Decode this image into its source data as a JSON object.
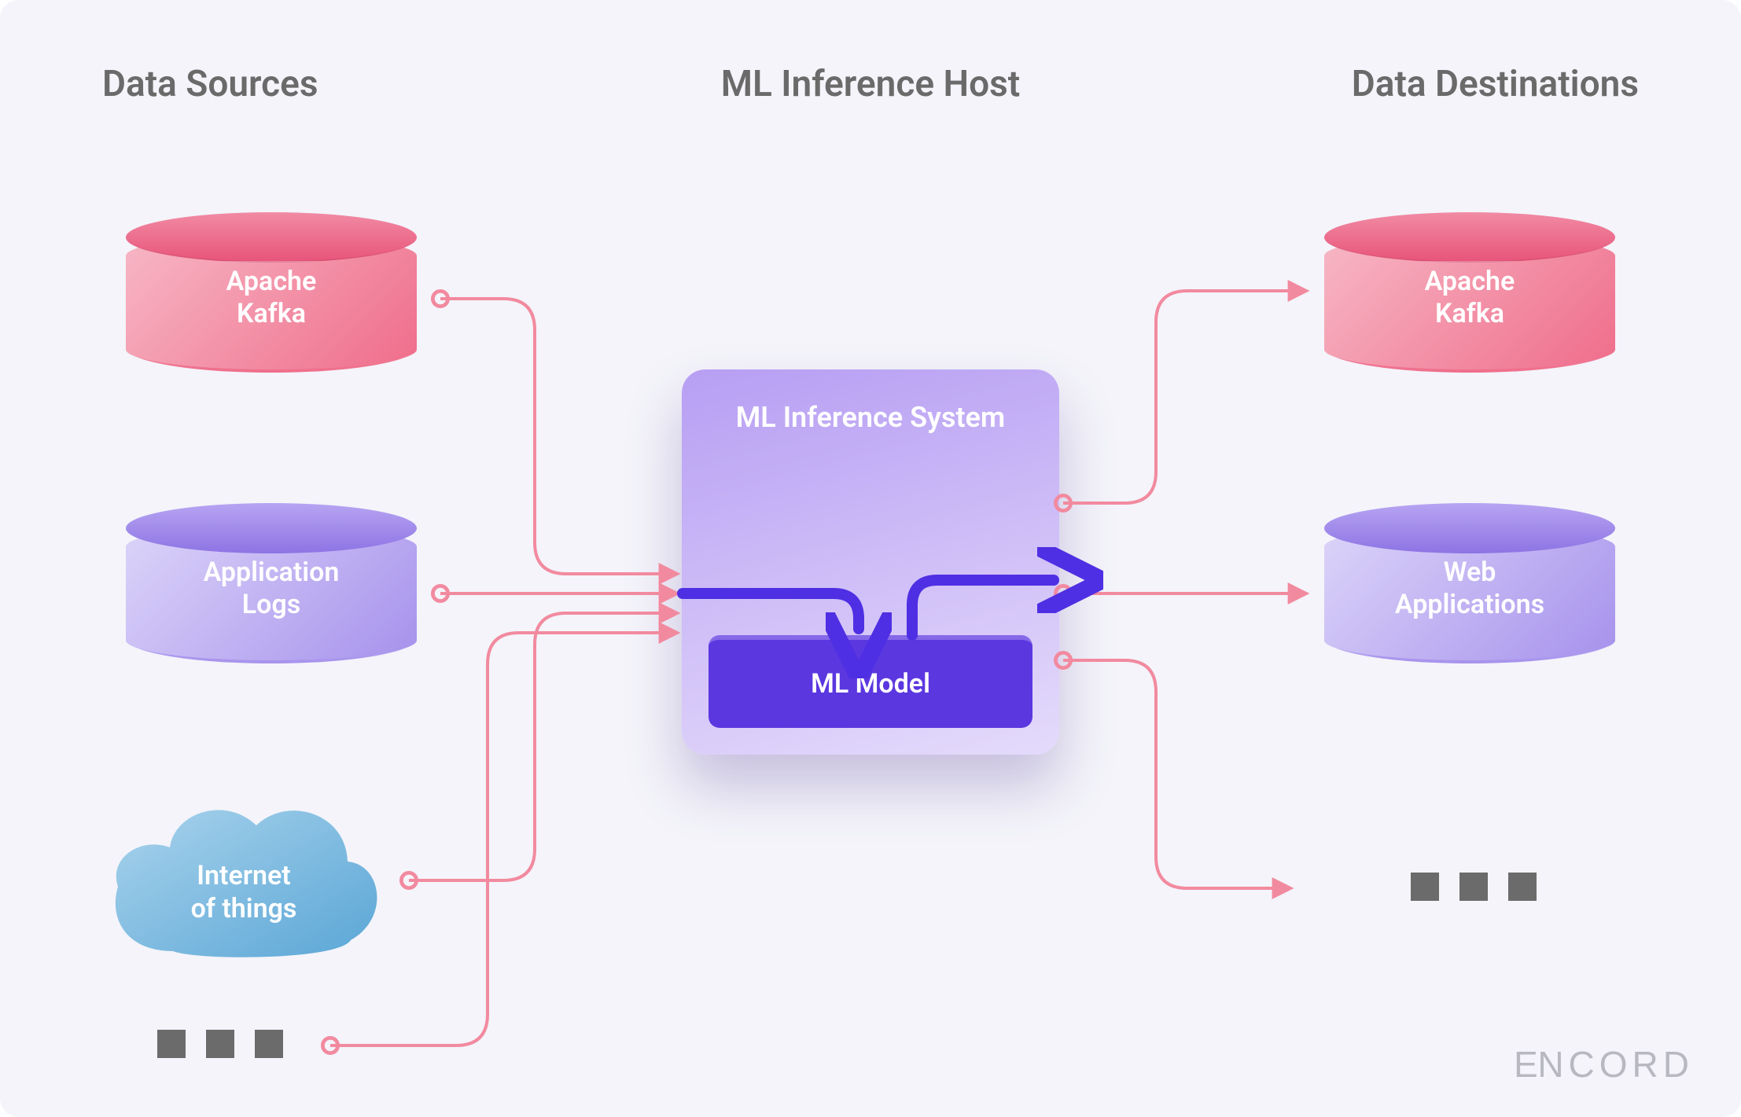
{
  "headings": {
    "sources": "Data Sources",
    "host": "ML Inference Host",
    "destinations": "Data Destinations"
  },
  "sources": {
    "kafka": "Apache\nKafka",
    "logs": "Application\nLogs",
    "iot": "Internet\nof things"
  },
  "center": {
    "system": "ML Inference System",
    "model": "ML Model"
  },
  "destinations": {
    "kafka": "Apache\nKafka",
    "webapps": "Web\nApplications"
  },
  "brand": "ENCORD",
  "colors": {
    "pink_arrows": "#f28a9f",
    "blue_arrows": "#4f2fe3"
  }
}
